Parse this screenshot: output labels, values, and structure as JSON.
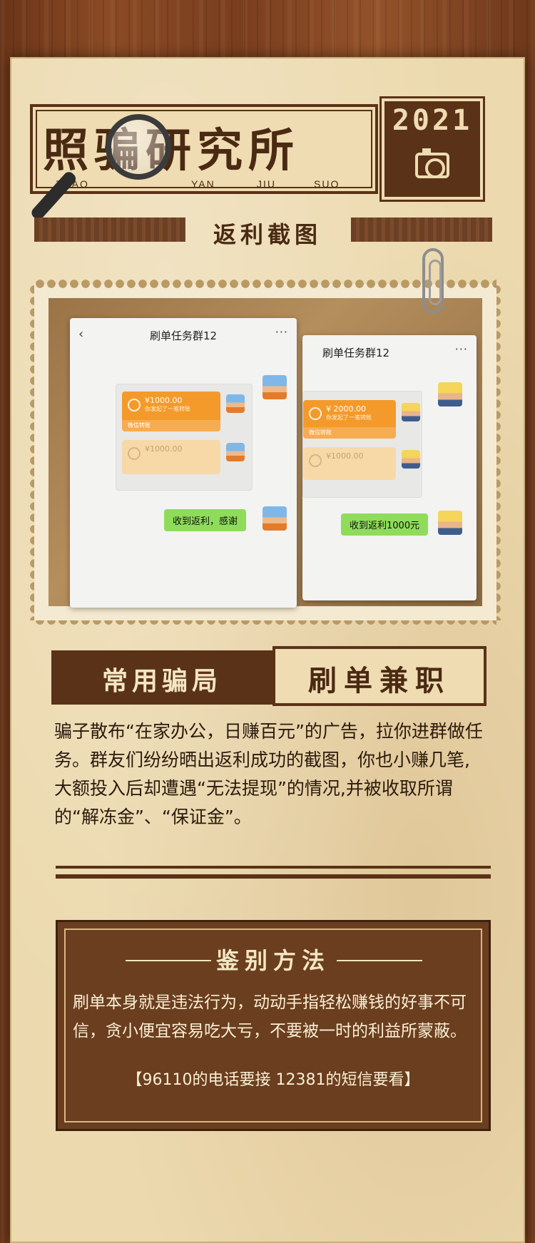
{
  "header": {
    "title": "照骗研究所",
    "pinyin": [
      "ZHAO",
      "YAN",
      "JIU",
      "SUO"
    ],
    "year": "2021",
    "subtitle": "返利截图"
  },
  "screenshots": {
    "left": {
      "title": "刷单任务群12",
      "back_icon": "‹",
      "more_icon": "···",
      "transfer_1_amount": "¥1000.00",
      "transfer_1_sub": "你发起了一笔转账",
      "transfer_1_footer": "微信转账",
      "transfer_2_amount": "¥1000.00",
      "reply": "收到返利，感谢"
    },
    "right": {
      "title": "刷单任务群12",
      "more_icon": "···",
      "transfer_1_amount": "¥ 2000.00",
      "transfer_1_sub": "你发起了一笔转账",
      "transfer_1_footer": "微信转账",
      "transfer_2_amount": "¥1000.00",
      "reply": "收到返利1000元"
    }
  },
  "section": {
    "label": "常用骗局",
    "name": "刷单兼职"
  },
  "description": "骗子散布“在家办公，日赚百元”的广告，拉你进群做任务。群友们纷纷晒出返利成功的截图，你也小赚几笔,大额投入后却遭遇“无法提现”的情况,并被收取所谓的“解冻金”、“保证金”。",
  "identify": {
    "title": "鉴别方法",
    "body": "刷单本身就是违法行为，动动手指轻松赚钱的好事不可信，贪小便宜容易吃大亏，不要被一时的利益所蒙蔽。",
    "note": "【96110的电话要接 12381的短信要看】"
  },
  "colors": {
    "wood": "#7a3e1e",
    "paper": "#ecd9ae",
    "brown": "#5a3217",
    "orange_transfer": "#f49a2a",
    "green_message": "#8fdc5a"
  }
}
